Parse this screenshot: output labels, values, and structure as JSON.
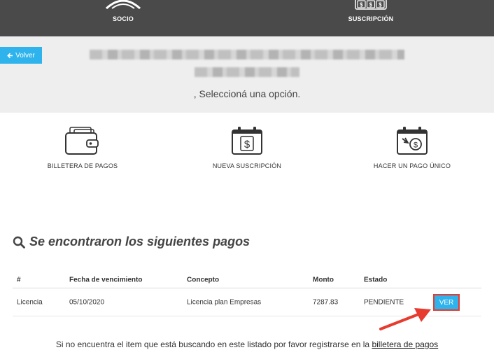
{
  "topnav": [
    {
      "label": "SOCIO",
      "icon": "person-icon"
    },
    {
      "label": "SUSCRIPCIÓN",
      "icon": "money-icon"
    }
  ],
  "back_button": {
    "label": "Volver",
    "icon": "arrow-left-icon"
  },
  "subtitle": ", Seleccioná una opción.",
  "options": [
    {
      "label": "BILLETERA DE PAGOS",
      "icon": "wallet-icon"
    },
    {
      "label": "NUEVA SUSCRIPCIÓN",
      "icon": "calendar-dollar-icon"
    },
    {
      "label": "HACER UN PAGO ÚNICO",
      "icon": "calendar-payment-icon"
    }
  ],
  "payments_title": "Se encontraron los siguientes pagos",
  "table": {
    "headers": [
      "#",
      "Fecha de vencimiento",
      "Concepto",
      "Monto",
      "Estado"
    ],
    "rows": [
      {
        "id": "Licencia",
        "due": "05/10/2020",
        "concept": "Licencia plan Empresas",
        "amount": "7287.83",
        "status": "PENDIENTE",
        "action": "VER"
      }
    ]
  },
  "footer": {
    "text": "Si no encuentra el item que está buscando en este listado por favor registrarse en la ",
    "link": "billetera de pagos"
  },
  "colors": {
    "topbar": "#4a4a4a",
    "accent": "#2fb3ec",
    "highlight": "#e63b2e",
    "band": "#eeeeee"
  }
}
